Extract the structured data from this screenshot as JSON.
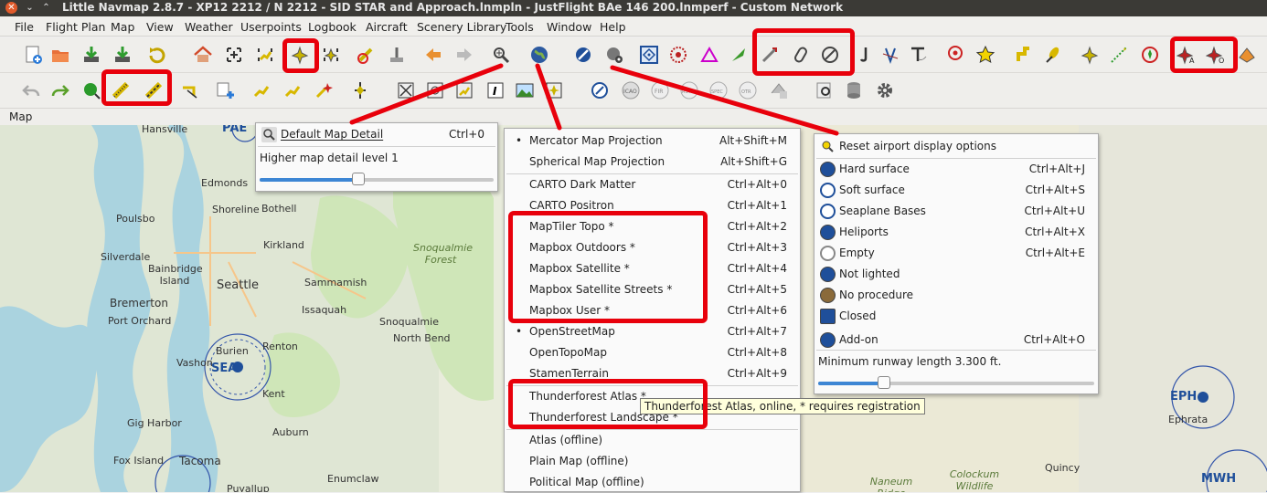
{
  "window": {
    "title": "Little Navmap 2.8.7 - XP12 2212 / N 2212 - SID STAR and Approach.lnmpln - JustFlight BAe 146 200.lnmperf - Custom Network"
  },
  "menu": [
    "File",
    "Flight Plan",
    "Map",
    "View",
    "Weather",
    "Userpoints",
    "Logbook",
    "Aircraft",
    "Scenery Library",
    "Tools",
    "Window",
    "Help"
  ],
  "dock_title": "Map",
  "detail_popup": {
    "default_label": "Default Map Detail",
    "default_shortcut": "Ctrl+0",
    "level_text": "Higher map detail level 1",
    "slider_value": 0.42
  },
  "theme_menu": {
    "items": [
      {
        "label": "Mercator Map Projection",
        "shortcut": "Alt+Shift+M",
        "checked": true
      },
      {
        "label": "Spherical Map Projection",
        "shortcut": "Alt+Shift+G",
        "checked": false
      },
      {
        "label": "CARTO Dark Matter",
        "shortcut": "Ctrl+Alt+0",
        "checked": false
      },
      {
        "label": "CARTO Positron",
        "shortcut": "Ctrl+Alt+1",
        "checked": false
      },
      {
        "label": "MapTiler Topo *",
        "shortcut": "Ctrl+Alt+2",
        "checked": false
      },
      {
        "label": "Mapbox Outdoors *",
        "shortcut": "Ctrl+Alt+3",
        "checked": false
      },
      {
        "label": "Mapbox Satellite *",
        "shortcut": "Ctrl+Alt+4",
        "checked": false
      },
      {
        "label": "Mapbox Satellite Streets *",
        "shortcut": "Ctrl+Alt+5",
        "checked": false
      },
      {
        "label": "Mapbox User *",
        "shortcut": "Ctrl+Alt+6",
        "checked": false
      },
      {
        "label": "OpenStreetMap",
        "shortcut": "Ctrl+Alt+7",
        "checked": true
      },
      {
        "label": "OpenTopoMap",
        "shortcut": "Ctrl+Alt+8",
        "checked": false
      },
      {
        "label": "StamenTerrain",
        "shortcut": "Ctrl+Alt+9",
        "checked": false
      },
      {
        "label": "Thunderforest Atlas *",
        "shortcut": "",
        "checked": false
      },
      {
        "label": "Thunderforest Landscape *",
        "shortcut": "",
        "checked": false
      },
      {
        "label": "Atlas (offline)",
        "shortcut": "",
        "checked": false
      },
      {
        "label": "Plain Map (offline)",
        "shortcut": "",
        "checked": false
      },
      {
        "label": "Political Map (offline)",
        "shortcut": "",
        "checked": false
      }
    ],
    "tooltip": "Thunderforest Atlas, online, * requires registration"
  },
  "airport_menu": {
    "reset_label": "Reset airport display options",
    "items": [
      {
        "label": "Hard surface",
        "shortcut": "Ctrl+Alt+J",
        "icon_color": "#1f4f9a"
      },
      {
        "label": "Soft surface",
        "shortcut": "Ctrl+Alt+S",
        "icon_color": "#1f4f9a"
      },
      {
        "label": "Seaplane Bases",
        "shortcut": "Ctrl+Alt+U",
        "icon_color": "#1f4f9a"
      },
      {
        "label": "Heliports",
        "shortcut": "Ctrl+Alt+X",
        "icon_color": "#1f4f9a"
      },
      {
        "label": "Empty",
        "shortcut": "Ctrl+Alt+E",
        "icon_color": "#888888"
      },
      {
        "label": "Not lighted",
        "shortcut": "",
        "icon_color": "#1f4f9a"
      },
      {
        "label": "No procedure",
        "shortcut": "",
        "icon_color": "#8a6a3a"
      },
      {
        "label": "Closed",
        "shortcut": "",
        "icon_color": "#1f4f9a"
      },
      {
        "label": "Add-on",
        "shortcut": "Ctrl+Alt+O",
        "icon_color": "#1f4f9a"
      }
    ],
    "runway_text": "Minimum runway length 3.300 ft.",
    "slider_value": 0.24
  },
  "map_labels": [
    "PAE",
    "Hansville",
    "Edmonds",
    "Poulsbo",
    "Shoreline",
    "Bothell",
    "Silverdale",
    "Kirkland",
    "Snoqualmie Forest",
    "Bainbridge Island",
    "Bremerton",
    "Seattle",
    "Sammamish",
    "Port Orchard",
    "Issaquah",
    "Snoqualmie",
    "North Bend",
    "Burien",
    "Renton",
    "SEA",
    "Vashon",
    "Kent",
    "Gig Harbor",
    "Auburn",
    "Fox Island",
    "Tacoma",
    "Enumclaw",
    "Puyallup",
    "EPH",
    "Ephrata",
    "Quincy",
    "MWH",
    "Naneum Ridge State",
    "Colockum Wildlife"
  ],
  "colors": {
    "highlight": "#e8000b",
    "water": "#aad3df",
    "green": "#cfe6b8",
    "accent": "#3d86d4"
  }
}
